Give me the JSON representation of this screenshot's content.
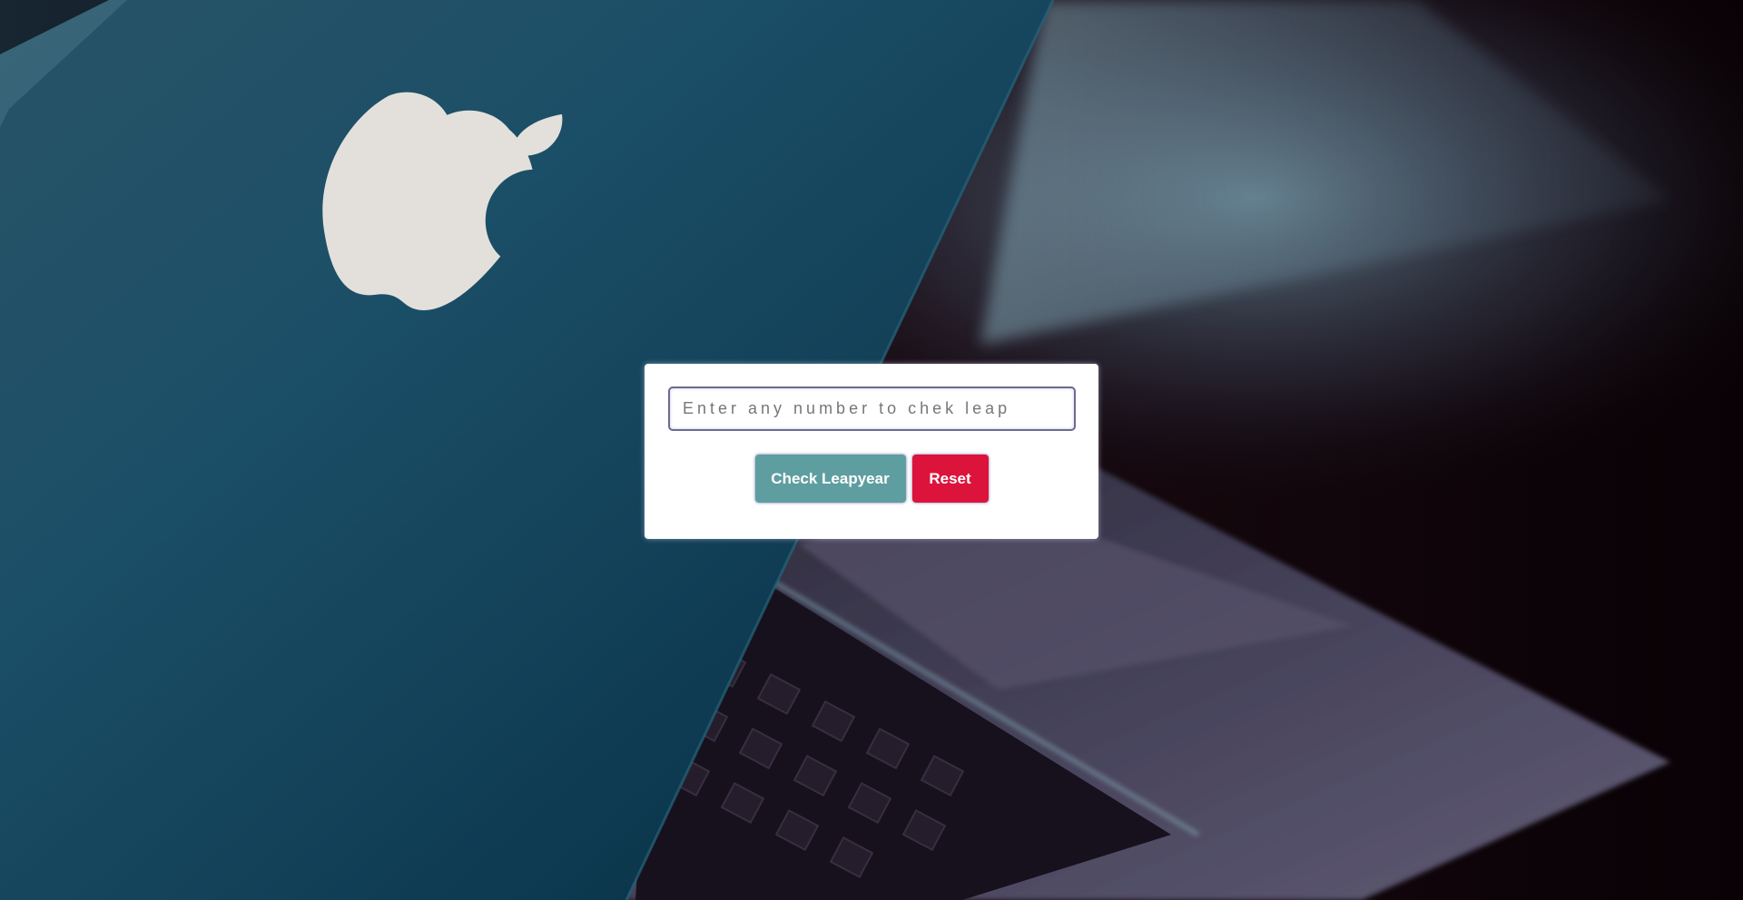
{
  "input": {
    "value": "",
    "placeholder": "Enter any number to chek leap"
  },
  "buttons": {
    "check_label": "Check Leapyear",
    "reset_label": "Reset"
  },
  "colors": {
    "check_button": "#5f9ea0",
    "reset_button": "#dc143c",
    "card_background": "#ffffff"
  },
  "background": {
    "description_icon": "laptop-photo-background"
  }
}
